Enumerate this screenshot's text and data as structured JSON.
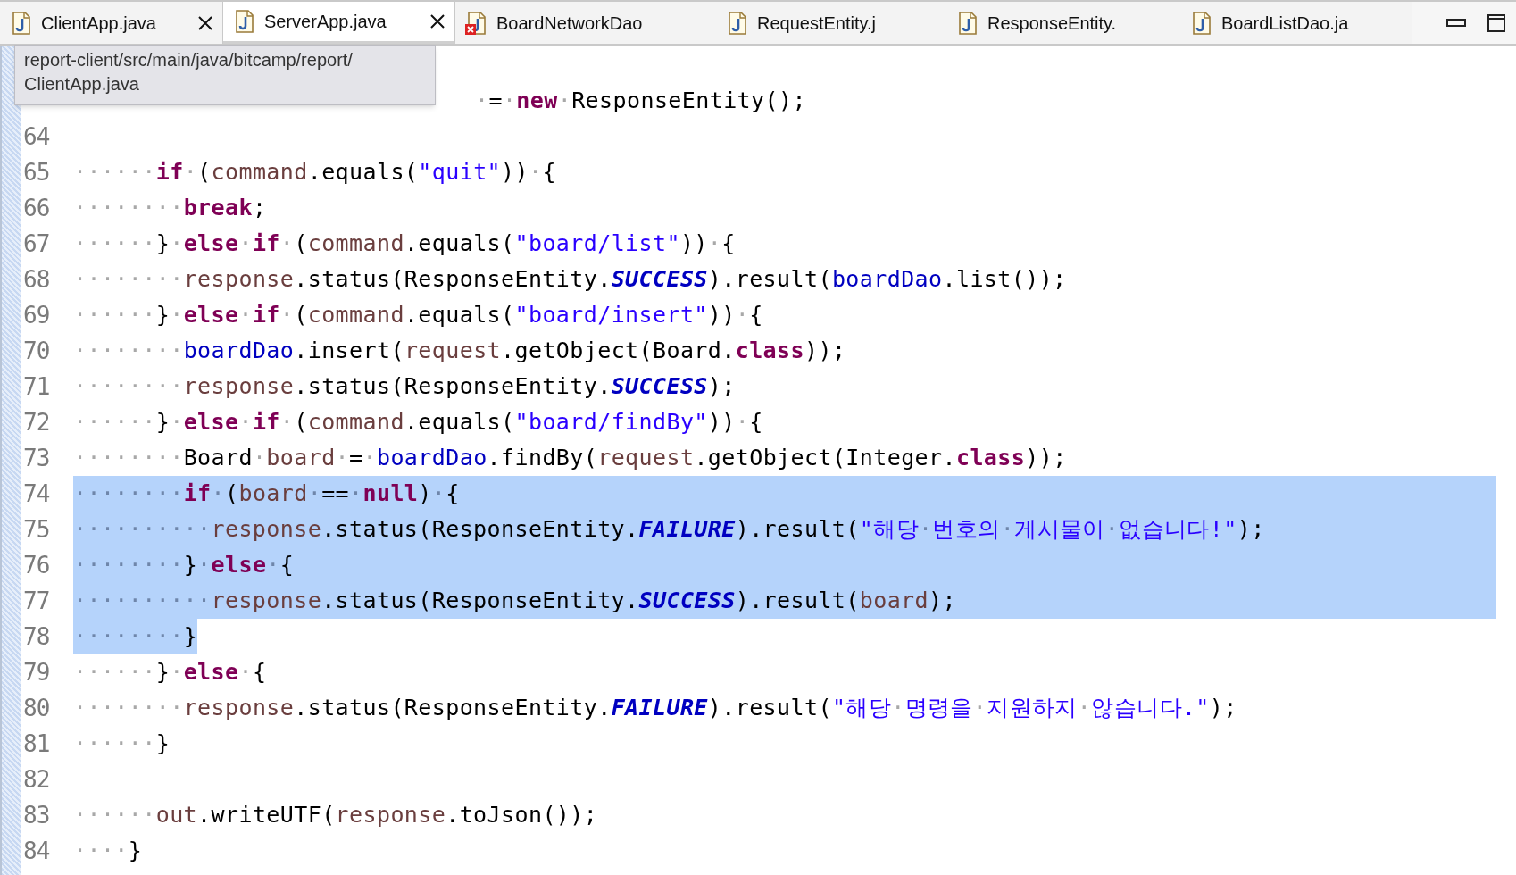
{
  "tabs": [
    {
      "label": "ClientApp.java",
      "selected": false,
      "closable": true,
      "error": false
    },
    {
      "label": "ServerApp.java",
      "selected": true,
      "closable": true,
      "error": false
    },
    {
      "label": "BoardNetworkDao",
      "selected": false,
      "closable": false,
      "error": true
    },
    {
      "label": "RequestEntity.j",
      "selected": false,
      "closable": false,
      "error": false
    },
    {
      "label": "ResponseEntity.",
      "selected": false,
      "closable": false,
      "error": false
    },
    {
      "label": "BoardListDao.ja",
      "selected": false,
      "closable": false,
      "error": false
    }
  ],
  "tooltip": {
    "lines": [
      "report-client/src/main/java/bitcamp/report/",
      "ClientApp.java"
    ]
  },
  "lines": [
    {
      "partial": true,
      "selected": false,
      "tokens": [
        {
          "kind": "ws",
          "text": "·"
        },
        {
          "kind": "p",
          "text": "="
        },
        {
          "kind": "ws",
          "text": "·"
        },
        {
          "kind": "kw",
          "text": "new"
        },
        {
          "kind": "ws",
          "text": "·"
        },
        {
          "kind": "p",
          "text": "ResponseEntity();"
        }
      ]
    },
    {
      "number": "64"
    },
    {
      "number": "65",
      "selected": false,
      "tokens": [
        {
          "kind": "ws",
          "text": "······"
        },
        {
          "kind": "kw",
          "text": "if"
        },
        {
          "kind": "ws",
          "text": "·"
        },
        {
          "kind": "p",
          "text": "("
        },
        {
          "kind": "loc",
          "text": "command"
        },
        {
          "kind": "p",
          "text": ".equals("
        },
        {
          "kind": "str",
          "text": "\"quit\""
        },
        {
          "kind": "p",
          "text": "))"
        },
        {
          "kind": "ws",
          "text": "·"
        },
        {
          "kind": "p",
          "text": "{"
        }
      ]
    },
    {
      "number": "66",
      "selected": false,
      "tokens": [
        {
          "kind": "ws",
          "text": "········"
        },
        {
          "kind": "kw",
          "text": "break"
        },
        {
          "kind": "p",
          "text": ";"
        }
      ]
    },
    {
      "number": "67",
      "selected": false,
      "tokens": [
        {
          "kind": "ws",
          "text": "······"
        },
        {
          "kind": "p",
          "text": "}"
        },
        {
          "kind": "ws",
          "text": "·"
        },
        {
          "kind": "kw",
          "text": "else"
        },
        {
          "kind": "ws",
          "text": "·"
        },
        {
          "kind": "kw",
          "text": "if"
        },
        {
          "kind": "ws",
          "text": "·"
        },
        {
          "kind": "p",
          "text": "("
        },
        {
          "kind": "loc",
          "text": "command"
        },
        {
          "kind": "p",
          "text": ".equals("
        },
        {
          "kind": "str",
          "text": "\"board/list\""
        },
        {
          "kind": "p",
          "text": "))"
        },
        {
          "kind": "ws",
          "text": "·"
        },
        {
          "kind": "p",
          "text": "{"
        }
      ]
    },
    {
      "number": "68",
      "selected": false,
      "tokens": [
        {
          "kind": "ws",
          "text": "········"
        },
        {
          "kind": "loc",
          "text": "response"
        },
        {
          "kind": "p",
          "text": ".status(ResponseEntity."
        },
        {
          "kind": "const",
          "text": "SUCCESS"
        },
        {
          "kind": "p",
          "text": ").result("
        },
        {
          "kind": "fld",
          "text": "boardDao"
        },
        {
          "kind": "p",
          "text": ".list());"
        }
      ]
    },
    {
      "number": "69",
      "selected": false,
      "tokens": [
        {
          "kind": "ws",
          "text": "······"
        },
        {
          "kind": "p",
          "text": "}"
        },
        {
          "kind": "ws",
          "text": "·"
        },
        {
          "kind": "kw",
          "text": "else"
        },
        {
          "kind": "ws",
          "text": "·"
        },
        {
          "kind": "kw",
          "text": "if"
        },
        {
          "kind": "ws",
          "text": "·"
        },
        {
          "kind": "p",
          "text": "("
        },
        {
          "kind": "loc",
          "text": "command"
        },
        {
          "kind": "p",
          "text": ".equals("
        },
        {
          "kind": "str",
          "text": "\"board/insert\""
        },
        {
          "kind": "p",
          "text": "))"
        },
        {
          "kind": "ws",
          "text": "·"
        },
        {
          "kind": "p",
          "text": "{"
        }
      ]
    },
    {
      "number": "70",
      "selected": false,
      "tokens": [
        {
          "kind": "ws",
          "text": "········"
        },
        {
          "kind": "fld",
          "text": "boardDao"
        },
        {
          "kind": "p",
          "text": ".insert("
        },
        {
          "kind": "loc",
          "text": "request"
        },
        {
          "kind": "p",
          "text": ".getObject(Board."
        },
        {
          "kind": "kw",
          "text": "class"
        },
        {
          "kind": "p",
          "text": "));"
        }
      ]
    },
    {
      "number": "71",
      "selected": false,
      "tokens": [
        {
          "kind": "ws",
          "text": "········"
        },
        {
          "kind": "loc",
          "text": "response"
        },
        {
          "kind": "p",
          "text": ".status(ResponseEntity."
        },
        {
          "kind": "const",
          "text": "SUCCESS"
        },
        {
          "kind": "p",
          "text": ");"
        }
      ]
    },
    {
      "number": "72",
      "selected": false,
      "tokens": [
        {
          "kind": "ws",
          "text": "······"
        },
        {
          "kind": "p",
          "text": "}"
        },
        {
          "kind": "ws",
          "text": "·"
        },
        {
          "kind": "kw",
          "text": "else"
        },
        {
          "kind": "ws",
          "text": "·"
        },
        {
          "kind": "kw",
          "text": "if"
        },
        {
          "kind": "ws",
          "text": "·"
        },
        {
          "kind": "p",
          "text": "("
        },
        {
          "kind": "loc",
          "text": "command"
        },
        {
          "kind": "p",
          "text": ".equals("
        },
        {
          "kind": "str",
          "text": "\"board/findBy\""
        },
        {
          "kind": "p",
          "text": "))"
        },
        {
          "kind": "ws",
          "text": "·"
        },
        {
          "kind": "p",
          "text": "{"
        }
      ]
    },
    {
      "number": "73",
      "selected": false,
      "tokens": [
        {
          "kind": "ws",
          "text": "········"
        },
        {
          "kind": "p",
          "text": "Board"
        },
        {
          "kind": "ws",
          "text": "·"
        },
        {
          "kind": "loc",
          "text": "board"
        },
        {
          "kind": "ws",
          "text": "·"
        },
        {
          "kind": "p",
          "text": "="
        },
        {
          "kind": "ws",
          "text": "·"
        },
        {
          "kind": "fld",
          "text": "boardDao"
        },
        {
          "kind": "p",
          "text": ".findBy("
        },
        {
          "kind": "loc",
          "text": "request"
        },
        {
          "kind": "p",
          "text": ".getObject(Integer."
        },
        {
          "kind": "kw",
          "text": "class"
        },
        {
          "kind": "p",
          "text": "));"
        }
      ]
    },
    {
      "number": "74",
      "selected": true,
      "tokens": [
        {
          "kind": "ws",
          "text": "········"
        },
        {
          "kind": "kw",
          "text": "if"
        },
        {
          "kind": "ws",
          "text": "·"
        },
        {
          "kind": "p",
          "text": "("
        },
        {
          "kind": "loc",
          "text": "board"
        },
        {
          "kind": "ws",
          "text": "·"
        },
        {
          "kind": "p",
          "text": "=="
        },
        {
          "kind": "ws",
          "text": "·"
        },
        {
          "kind": "kw",
          "text": "null"
        },
        {
          "kind": "p",
          "text": ")"
        },
        {
          "kind": "ws",
          "text": "·"
        },
        {
          "kind": "p",
          "text": "{"
        }
      ]
    },
    {
      "number": "75",
      "selected": true,
      "tokens": [
        {
          "kind": "ws",
          "text": "··········"
        },
        {
          "kind": "loc",
          "text": "response"
        },
        {
          "kind": "p",
          "text": ".status(ResponseEntity."
        },
        {
          "kind": "const",
          "text": "FAILURE"
        },
        {
          "kind": "p",
          "text": ").result("
        },
        {
          "kind": "str",
          "text": "\"해당"
        },
        {
          "kind": "ws",
          "text": "·"
        },
        {
          "kind": "str",
          "text": "번호의"
        },
        {
          "kind": "ws",
          "text": "·"
        },
        {
          "kind": "str",
          "text": "게시물이"
        },
        {
          "kind": "ws",
          "text": "·"
        },
        {
          "kind": "str",
          "text": "없습니다!\""
        },
        {
          "kind": "p",
          "text": ");"
        }
      ]
    },
    {
      "number": "76",
      "selected": true,
      "tokens": [
        {
          "kind": "ws",
          "text": "········"
        },
        {
          "kind": "p",
          "text": "}"
        },
        {
          "kind": "ws",
          "text": "·"
        },
        {
          "kind": "kw",
          "text": "else"
        },
        {
          "kind": "ws",
          "text": "·"
        },
        {
          "kind": "p",
          "text": "{"
        }
      ]
    },
    {
      "number": "77",
      "selected": true,
      "tokens": [
        {
          "kind": "ws",
          "text": "··········"
        },
        {
          "kind": "loc",
          "text": "response"
        },
        {
          "kind": "p",
          "text": ".status(ResponseEntity."
        },
        {
          "kind": "const",
          "text": "SUCCESS"
        },
        {
          "kind": "p",
          "text": ").result("
        },
        {
          "kind": "loc",
          "text": "board"
        },
        {
          "kind": "p",
          "text": ");"
        }
      ]
    },
    {
      "number": "78",
      "selected": true,
      "tokens": [
        {
          "kind": "ws",
          "text": "········"
        },
        {
          "kind": "p",
          "text": "}"
        }
      ]
    },
    {
      "number": "79",
      "selected": false,
      "tokens": [
        {
          "kind": "ws",
          "text": "······"
        },
        {
          "kind": "p",
          "text": "}"
        },
        {
          "kind": "ws",
          "text": "·"
        },
        {
          "kind": "kw",
          "text": "else"
        },
        {
          "kind": "ws",
          "text": "·"
        },
        {
          "kind": "p",
          "text": "{"
        }
      ]
    },
    {
      "number": "80",
      "selected": false,
      "tokens": [
        {
          "kind": "ws",
          "text": "········"
        },
        {
          "kind": "loc",
          "text": "response"
        },
        {
          "kind": "p",
          "text": ".status(ResponseEntity."
        },
        {
          "kind": "const",
          "text": "FAILURE"
        },
        {
          "kind": "p",
          "text": ").result("
        },
        {
          "kind": "str",
          "text": "\"해당"
        },
        {
          "kind": "ws",
          "text": "·"
        },
        {
          "kind": "str",
          "text": "명령을"
        },
        {
          "kind": "ws",
          "text": "·"
        },
        {
          "kind": "str",
          "text": "지원하지"
        },
        {
          "kind": "ws",
          "text": "·"
        },
        {
          "kind": "str",
          "text": "않습니다.\""
        },
        {
          "kind": "p",
          "text": ");"
        }
      ]
    },
    {
      "number": "81",
      "selected": false,
      "tokens": [
        {
          "kind": "ws",
          "text": "······"
        },
        {
          "kind": "p",
          "text": "}"
        }
      ]
    },
    {
      "number": "82"
    },
    {
      "number": "83",
      "selected": false,
      "tokens": [
        {
          "kind": "ws",
          "text": "······"
        },
        {
          "kind": "loc",
          "text": "out"
        },
        {
          "kind": "p",
          "text": ".writeUTF("
        },
        {
          "kind": "loc",
          "text": "response"
        },
        {
          "kind": "p",
          "text": ".toJson());"
        }
      ]
    },
    {
      "number": "84",
      "selected": false,
      "tokens": [
        {
          "kind": "ws",
          "text": "····"
        },
        {
          "kind": "p",
          "text": "}"
        }
      ]
    }
  ]
}
